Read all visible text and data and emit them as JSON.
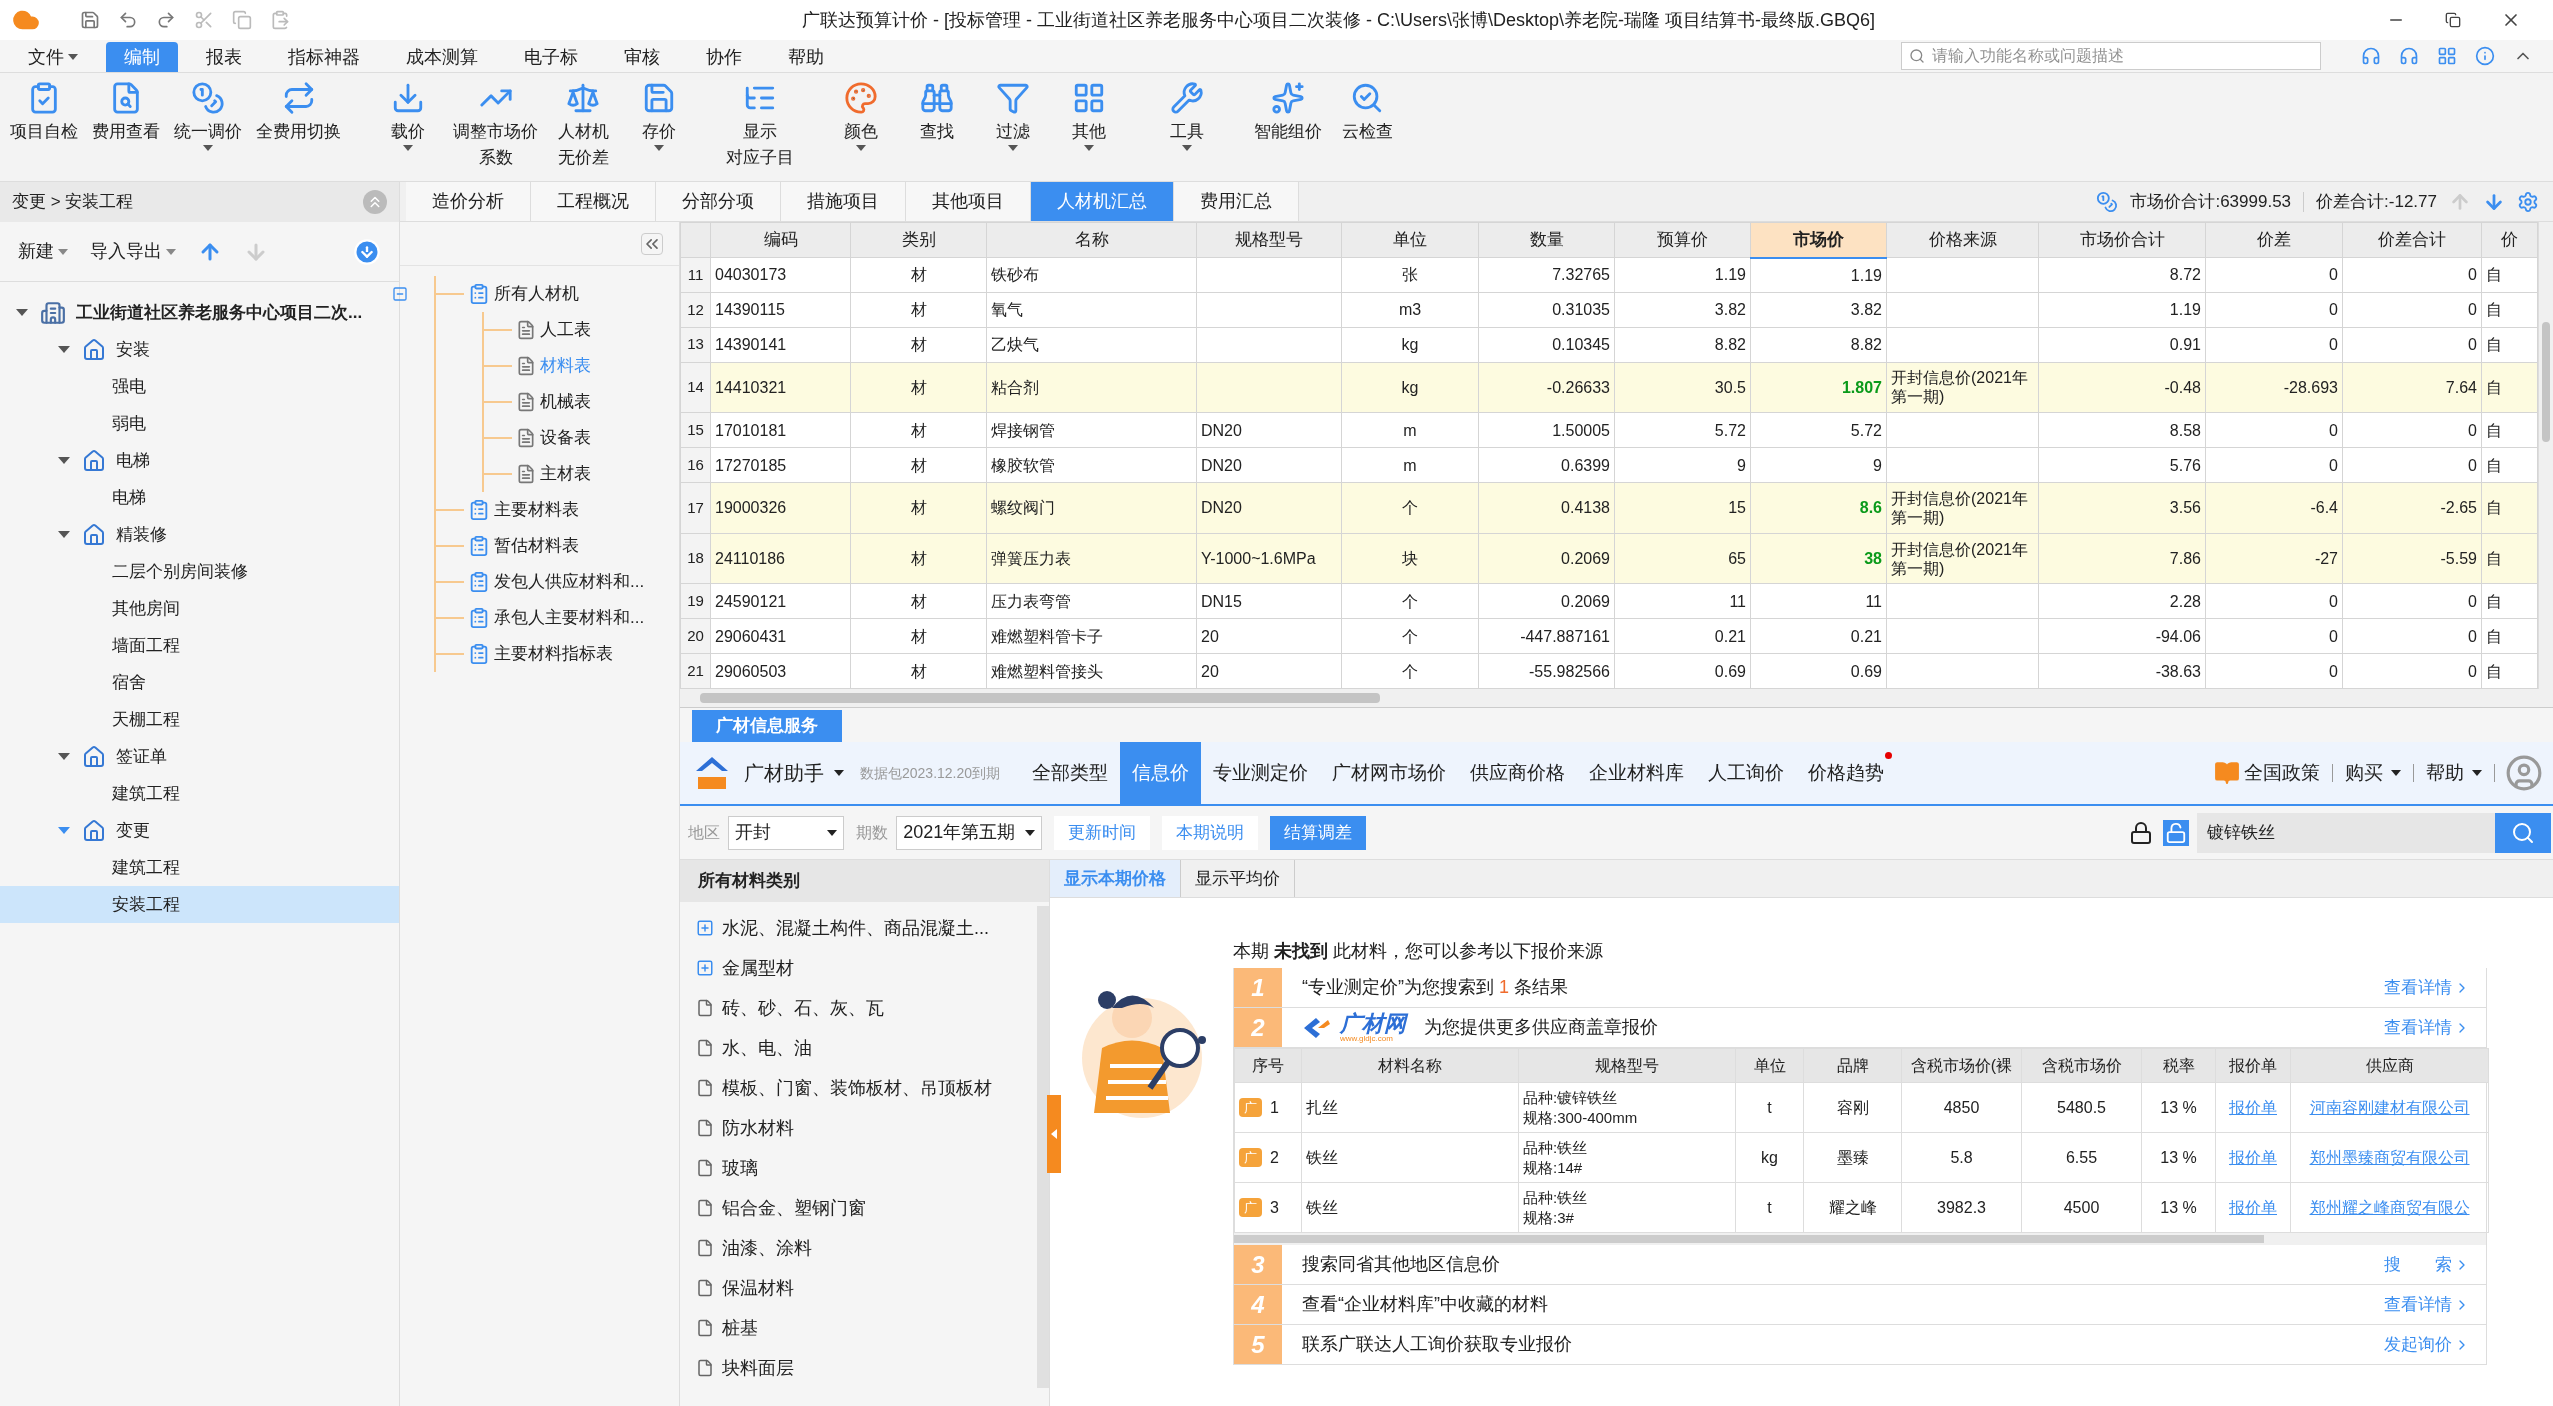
{
  "window": {
    "title": "广联达预算计价 - [投标管理 - 工业街道社区养老服务中心项目二次装修 - C:\\Users\\张博\\Desktop\\养老院-瑞隆 项目结算书-最终版.GBQ6]"
  },
  "menu": [
    {
      "label": "文件",
      "selected": false,
      "dropdown": true
    },
    {
      "label": "编制",
      "selected": true,
      "dropdown": false
    },
    {
      "label": "报表",
      "selected": false,
      "dropdown": false
    },
    {
      "label": "指标神器",
      "selected": false,
      "dropdown": false
    },
    {
      "label": "成本测算",
      "selected": false,
      "dropdown": false
    },
    {
      "label": "电子标",
      "selected": false,
      "dropdown": false
    },
    {
      "label": "审核",
      "selected": false,
      "dropdown": false
    },
    {
      "label": "协作",
      "selected": false,
      "dropdown": false
    },
    {
      "label": "帮助",
      "selected": false,
      "dropdown": false
    }
  ],
  "search": {
    "placeholder": "请输入功能名称或问题描述"
  },
  "ribbon": [
    {
      "label": "项目自检",
      "dropdown": false
    },
    {
      "label": "费用查看",
      "dropdown": false
    },
    {
      "label": "统一调价",
      "dropdown": true
    },
    {
      "label": "全费用切换",
      "dropdown": false
    },
    {
      "label": "载价",
      "dropdown": true
    },
    {
      "label": [
        "调整市场价",
        "系数"
      ],
      "dropdown": false
    },
    {
      "label": [
        "人材机",
        "无价差"
      ],
      "dropdown": false
    },
    {
      "label": "存价",
      "dropdown": true
    },
    {
      "label": [
        "显示",
        "对应子目"
      ],
      "dropdown": false
    },
    {
      "label": "颜色",
      "dropdown": true
    },
    {
      "label": "查找",
      "dropdown": false
    },
    {
      "label": "过滤",
      "dropdown": true
    },
    {
      "label": "其他",
      "dropdown": true
    },
    {
      "label": "工具",
      "dropdown": true
    },
    {
      "label": "智能组价",
      "dropdown": false
    },
    {
      "label": "云检查",
      "dropdown": false
    }
  ],
  "left_panel": {
    "breadcrumb": "变更 > 安装工程",
    "toolbar": [
      {
        "label": "新建",
        "dropdown": true
      },
      {
        "label": "导入导出",
        "dropdown": true
      }
    ],
    "tree": [
      {
        "label": "工业街道社区养老服务中心项目二次...",
        "expanded": true,
        "selected": false,
        "children": [
          {
            "label": "安装",
            "expanded": true,
            "selected": false,
            "children": [
              {
                "label": "强电",
                "selected": false
              },
              {
                "label": "弱电",
                "selected": false
              }
            ]
          },
          {
            "label": "电梯",
            "expanded": true,
            "selected": false,
            "children": [
              {
                "label": "电梯",
                "selected": false
              }
            ]
          },
          {
            "label": "精装修",
            "expanded": true,
            "selected": false,
            "children": [
              {
                "label": "二层个别房间装修",
                "selected": false
              },
              {
                "label": "其他房间",
                "selected": false
              },
              {
                "label": "墙面工程",
                "selected": false
              },
              {
                "label": "宿舍",
                "selected": false
              },
              {
                "label": "天棚工程",
                "selected": false
              }
            ]
          },
          {
            "label": "签证单",
            "expanded": true,
            "selected": false,
            "children": [
              {
                "label": "建筑工程",
                "selected": false
              }
            ]
          },
          {
            "label": "变更",
            "expanded": true,
            "selected": false,
            "children": [
              {
                "label": "建筑工程",
                "selected": false
              },
              {
                "label": "安装工程",
                "selected": true
              }
            ]
          }
        ]
      }
    ]
  },
  "tabs": [
    {
      "label": "造价分析",
      "selected": false
    },
    {
      "label": "工程概况",
      "selected": false
    },
    {
      "label": "分部分项",
      "selected": false
    },
    {
      "label": "措施项目",
      "selected": false
    },
    {
      "label": "其他项目",
      "selected": false
    },
    {
      "label": "人材机汇总",
      "selected": true
    },
    {
      "label": "费用汇总",
      "selected": false
    }
  ],
  "totals": {
    "market": "市场价合计:63999.53",
    "diff": "价差合计:-12.77"
  },
  "category_tree": [
    {
      "label": "所有人材机",
      "expanded": true,
      "selected": false,
      "children": [
        {
          "label": "人工表",
          "selected": false
        },
        {
          "label": "材料表",
          "selected": true
        },
        {
          "label": "机械表",
          "selected": false
        },
        {
          "label": "设备表",
          "selected": false
        },
        {
          "label": "主材表",
          "selected": false
        }
      ]
    },
    {
      "label": "主要材料表",
      "selected": false
    },
    {
      "label": "暂估材料表",
      "selected": false
    },
    {
      "label": "发包人供应材料和...",
      "selected": false
    },
    {
      "label": "承包人主要材料和...",
      "selected": false
    },
    {
      "label": "主要材料指标表",
      "selected": false
    }
  ],
  "table": {
    "columns": [
      {
        "label": "编码",
        "selected": false
      },
      {
        "label": "类别",
        "selected": false
      },
      {
        "label": "名称",
        "selected": false
      },
      {
        "label": "规格型号",
        "selected": false
      },
      {
        "label": "单位",
        "selected": false
      },
      {
        "label": "数量",
        "selected": false
      },
      {
        "label": "预算价",
        "selected": false
      },
      {
        "label": "市场价",
        "selected": true
      },
      {
        "label": "价格来源",
        "selected": false
      },
      {
        "label": "市场价合计",
        "selected": false
      },
      {
        "label": "价差",
        "selected": false
      },
      {
        "label": "价差合计",
        "selected": false
      },
      {
        "label": "价",
        "selected": false
      }
    ],
    "rows": [
      {
        "no": "11",
        "highlighted": false,
        "cells": [
          "04030173",
          "材",
          "铁砂布",
          null,
          "张",
          "7.32765",
          "1.19",
          "1.19",
          null,
          "8.72",
          "0",
          "0",
          "自"
        ]
      },
      {
        "no": "12",
        "highlighted": false,
        "cells": [
          "14390115",
          "材",
          "氧气",
          null,
          "m3",
          "0.31035",
          "3.82",
          "3.82",
          null,
          "1.19",
          "0",
          "0",
          "自"
        ]
      },
      {
        "no": "13",
        "highlighted": false,
        "cells": [
          "14390141",
          "材",
          "乙炔气",
          null,
          "kg",
          "0.10345",
          "8.82",
          "8.82",
          null,
          "0.91",
          "0",
          "0",
          "自"
        ]
      },
      {
        "no": "14",
        "highlighted": true,
        "cells": [
          "14410321",
          "材",
          "粘合剂",
          null,
          "kg",
          "-0.26633",
          "30.5",
          "1.807",
          "开封信息价(2021年第一期)",
          "-0.48",
          "-28.693",
          "7.64",
          "自"
        ]
      },
      {
        "no": "15",
        "highlighted": false,
        "cells": [
          "17010181",
          "材",
          "焊接钢管",
          "DN20",
          "m",
          "1.50005",
          "5.72",
          "5.72",
          null,
          "8.58",
          "0",
          "0",
          "自"
        ]
      },
      {
        "no": "16",
        "highlighted": false,
        "cells": [
          "17270185",
          "材",
          "橡胶软管",
          "DN20",
          "m",
          "0.6399",
          "9",
          "9",
          null,
          "5.76",
          "0",
          "0",
          "自"
        ]
      },
      {
        "no": "17",
        "highlighted": true,
        "cells": [
          "19000326",
          "材",
          "螺纹阀门",
          "DN20",
          "个",
          "0.4138",
          "15",
          "8.6",
          "开封信息价(2021年第一期)",
          "3.56",
          "-6.4",
          "-2.65",
          "自"
        ]
      },
      {
        "no": "18",
        "highlighted": true,
        "cells": [
          "24110186",
          "材",
          "弹簧压力表",
          "Y-1000~1.6MPa",
          "块",
          "0.2069",
          "65",
          "38",
          "开封信息价(2021年第一期)",
          "7.86",
          "-27",
          "-5.59",
          "自"
        ]
      },
      {
        "no": "19",
        "highlighted": false,
        "cells": [
          "24590121",
          "材",
          "压力表弯管",
          "DN15",
          "个",
          "0.2069",
          "11",
          "11",
          null,
          "2.28",
          "0",
          "0",
          "自"
        ]
      },
      {
        "no": "20",
        "highlighted": false,
        "cells": [
          "29060431",
          "材",
          "难燃塑料管卡子",
          "20",
          "个",
          "-447.887161",
          "0.21",
          "0.21",
          null,
          "-94.06",
          "0",
          "0",
          "自"
        ]
      },
      {
        "no": "21",
        "highlighted": false,
        "cells": [
          "29060503",
          "材",
          "难燃塑料管接头",
          "20",
          "个",
          "-55.982566",
          "0.69",
          "0.69",
          null,
          "-38.63",
          "0",
          "0",
          "自"
        ]
      }
    ]
  },
  "info_service": {
    "tab": "广材信息服务",
    "assistant": "广材助手",
    "package": "数据包2023.12.20到期",
    "nav": [
      {
        "label": "全部类型",
        "selected": false,
        "dot": false
      },
      {
        "label": "信息价",
        "selected": true,
        "dot": false
      },
      {
        "label": "专业测定价",
        "selected": false,
        "dot": false
      },
      {
        "label": "广材网市场价",
        "selected": false,
        "dot": false
      },
      {
        "label": "供应商价格",
        "selected": false,
        "dot": false
      },
      {
        "label": "企业材料库",
        "selected": false,
        "dot": false
      },
      {
        "label": "人工询价",
        "selected": false,
        "dot": false
      },
      {
        "label": "价格趋势",
        "selected": false,
        "dot": true
      }
    ],
    "policy": "全国政策",
    "buy": "购买",
    "help": "帮助",
    "region_label": "地区",
    "region": "开封",
    "period_label": "期数",
    "period": "2021年第五期",
    "actions": [
      {
        "label": "更新时间",
        "selected": false
      },
      {
        "label": "本期说明",
        "selected": false
      },
      {
        "label": "结算调差",
        "selected": true
      }
    ],
    "search_value": "镀锌铁丝",
    "categories_title": "所有材料类别",
    "categories": [
      {
        "label": "水泥、混凝土构件、商品混凝土...",
        "kind": "group"
      },
      {
        "label": "金属型材",
        "kind": "group"
      },
      {
        "label": "砖、砂、石、灰、瓦",
        "kind": "leaf"
      },
      {
        "label": "水、电、油",
        "kind": "leaf"
      },
      {
        "label": "模板、门窗、装饰板材、吊顶板材",
        "kind": "leaf"
      },
      {
        "label": "防水材料",
        "kind": "leaf"
      },
      {
        "label": "玻璃",
        "kind": "leaf"
      },
      {
        "label": "铝合金、塑钢门窗",
        "kind": "leaf"
      },
      {
        "label": "油漆、涂料",
        "kind": "leaf"
      },
      {
        "label": "保温材料",
        "kind": "leaf"
      },
      {
        "label": "桩基",
        "kind": "leaf"
      },
      {
        "label": "块料面层",
        "kind": "leaf"
      }
    ],
    "view_tabs": [
      {
        "label": "显示本期价格",
        "selected": true
      },
      {
        "label": "显示平均价",
        "selected": false
      }
    ],
    "notice": "本期 **未找到** 此材料，您可以参考以下报价来源",
    "steps": [
      {
        "no": "1",
        "kind": "result",
        "before": "“专业测定价”为您搜索到",
        "count": "1",
        "after": "条结果",
        "link": "查看详情"
      },
      {
        "no": "2",
        "kind": "brand",
        "brand": "广材网",
        "url": "www.gldjc.com",
        "text": "为您提供更多供应商盖章报价",
        "link": "查看详情"
      },
      {
        "no": "3",
        "kind": "plain",
        "text": "搜索同省其他地区信息价",
        "link": "搜　　索"
      },
      {
        "no": "4",
        "kind": "plain",
        "text": "查看“企业材料库”中收藏的材料",
        "link": "查看详情"
      },
      {
        "no": "5",
        "kind": "plain",
        "text": "联系广联达人工询价获取专业报价",
        "link": "发起询价"
      }
    ],
    "suppliers": {
      "columns": [
        "序号",
        "材料名称",
        "规格型号",
        "单位",
        "品牌",
        "含税市场价(裸",
        "含税市场价",
        "税率",
        "报价单",
        "供应商"
      ],
      "rows": [
        {
          "badge": "广",
          "no": "1",
          "name": "扎丝",
          "spec": [
            "品种:镀锌铁丝",
            "规格:300-400mm"
          ],
          "unit": "t",
          "brand": "容刚",
          "price_bare": "4850",
          "price": "5480.5",
          "tax": "13 %",
          "quote": "报价单",
          "supplier": "河南容刚建材有限公司"
        },
        {
          "badge": "广",
          "no": "2",
          "name": "铁丝",
          "spec": [
            "品种:铁丝",
            "规格:14#"
          ],
          "unit": "kg",
          "brand": "墨臻",
          "price_bare": "5.8",
          "price": "6.55",
          "tax": "13 %",
          "quote": "报价单",
          "supplier": "郑州墨臻商贸有限公司"
        },
        {
          "badge": "广",
          "no": "3",
          "name": "铁丝",
          "spec": [
            "品种:铁丝",
            "规格:3#"
          ],
          "unit": "t",
          "brand": "耀之峰",
          "price_bare": "3982.3",
          "price": "4500",
          "tax": "13 %",
          "quote": "报价单",
          "supplier": "郑州耀之峰商贸有限公"
        }
      ]
    }
  }
}
